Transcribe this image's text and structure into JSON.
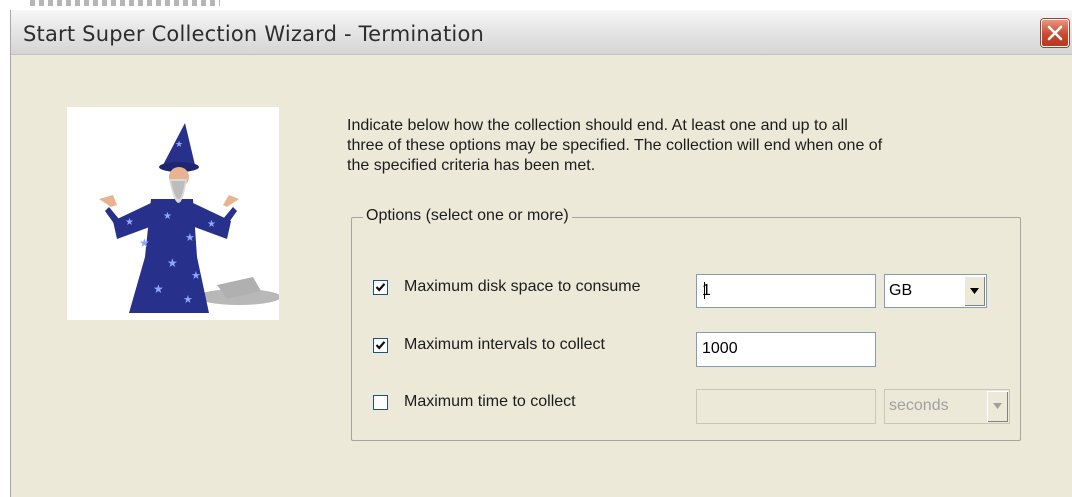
{
  "window": {
    "title": "Start Super Collection Wizard - Termination"
  },
  "intro_text": "Indicate below how the collection should end.  At least one and up to all\nthree of these options may be specified.  The collection will end when one of\nthe specified criteria has been met.",
  "options": {
    "group_label": "Options (select one or more)",
    "disk_space": {
      "label": "Maximum disk space to consume",
      "checked": true,
      "value": "1",
      "unit": "GB"
    },
    "intervals": {
      "label": "Maximum intervals to collect",
      "checked": true,
      "value": "1000"
    },
    "time": {
      "label": "Maximum time to collect",
      "checked": false,
      "value": "",
      "unit": "seconds",
      "disabled": true
    }
  },
  "icons": {
    "close": "close-icon",
    "wizard": "wizard-figure-icon",
    "check": "checkmark-icon",
    "dropdown": "dropdown-arrow-icon"
  },
  "colors": {
    "dialog_bg": "#ece9d8",
    "close_button": "#c9482f",
    "wizard_robe": "#27308a",
    "field_border": "#7f9db9"
  }
}
